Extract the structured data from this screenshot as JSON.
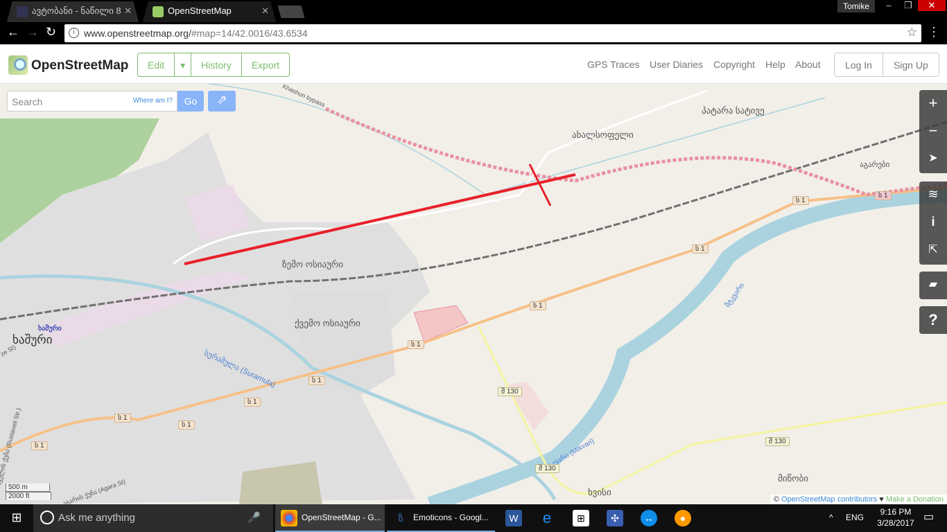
{
  "browser": {
    "tabs": [
      {
        "label": "ავტობანი - ნაწილი 8"
      },
      {
        "label": "OpenStreetMap"
      }
    ],
    "user": "Tomike",
    "url_host": "www.openstreetmap.org/",
    "url_rest": "#map=14/42.0016/43.6534"
  },
  "header": {
    "brand": "OpenStreetMap",
    "edit": "Edit",
    "history": "History",
    "export": "Export",
    "links": [
      "GPS Traces",
      "User Diaries",
      "Copyright",
      "Help",
      "About"
    ],
    "login": "Log In",
    "signup": "Sign Up"
  },
  "search": {
    "placeholder": "Search",
    "where_am_i": "Where am I?",
    "go": "Go"
  },
  "map": {
    "labels": {
      "zemo": "ზემო ოსიაური",
      "kvemo": "ქვემო ოსიაური",
      "khashuri": "ხაშური",
      "khashuri_station": "ხაშური",
      "suramula": "სურამულა (Suramula)",
      "mtkvari": "მტკვარი (Mtkvari)",
      "mtkvari2": "მტკვარი",
      "akhalsopeli": "ახალსოფელი",
      "patara": "პატარა სატივე",
      "agarebi": "აგარები",
      "khvisi": "ხვისი",
      "mitsobi": "მიწობი",
      "bypass": "Khashuri bypass",
      "rustaveli": "რუსთაველის ქუჩა (Rustaveli Str.)",
      "agara": "აგარის ქუჩა (Agara St)",
      "ze": "ze St)"
    },
    "shields": {
      "s1": "ს 1",
      "sh130": "შ 130"
    },
    "scale": {
      "metric": "500 m",
      "imperial": "2000 ft"
    },
    "attribution": {
      "copy": "©",
      "contributors": "OpenStreetMap contributors",
      "heart": "♥",
      "donate": "Make a Donation"
    }
  },
  "controls": {
    "zoom_in": "+",
    "zoom_out": "−",
    "help": "?"
  },
  "taskbar": {
    "search": "Ask me anything",
    "apps": [
      "OpenStreetMap - G...",
      "Emoticons - Googl..."
    ],
    "lang": "ENG",
    "time": "9:16 PM",
    "date": "3/28/2017"
  },
  "colors": {
    "osm_green": "#7ebc6f",
    "trunk": "#f7c088",
    "motorway_construction": "#e892a2",
    "water": "#aad3df",
    "annotation": "#e8202a"
  }
}
